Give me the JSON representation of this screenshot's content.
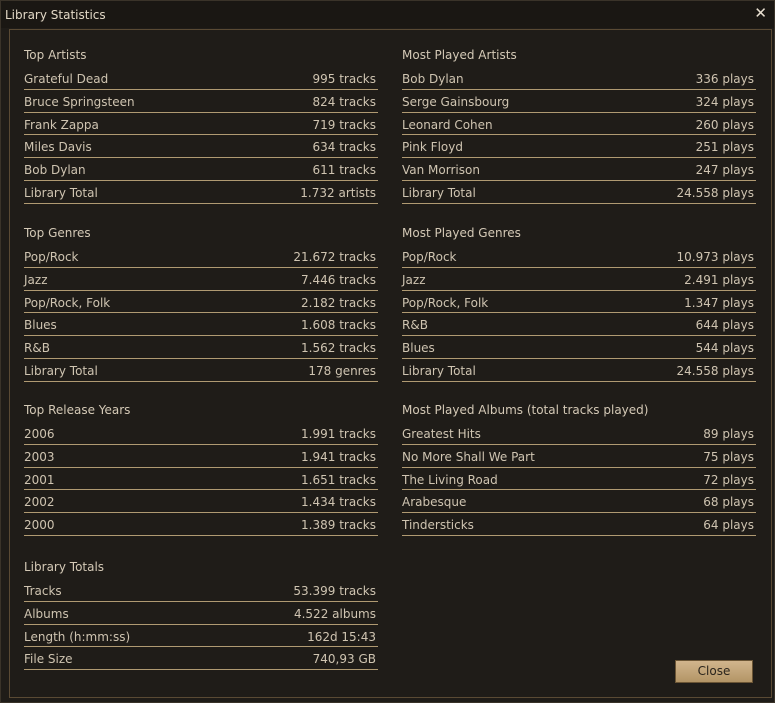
{
  "window": {
    "title": "Library Statistics",
    "close_glyph": "✕"
  },
  "left": {
    "top_artists": {
      "title": "Top Artists",
      "rows": [
        {
          "label": "Grateful Dead",
          "value": "995 tracks"
        },
        {
          "label": "Bruce Springsteen",
          "value": "824 tracks"
        },
        {
          "label": "Frank Zappa",
          "value": "719 tracks"
        },
        {
          "label": "Miles Davis",
          "value": "634 tracks"
        },
        {
          "label": "Bob Dylan",
          "value": "611 tracks"
        },
        {
          "label": "Library Total",
          "value": "1.732 artists"
        }
      ]
    },
    "top_genres": {
      "title": "Top Genres",
      "rows": [
        {
          "label": "Pop/Rock",
          "value": "21.672 tracks"
        },
        {
          "label": "Jazz",
          "value": "7.446 tracks"
        },
        {
          "label": "Pop/Rock, Folk",
          "value": "2.182 tracks"
        },
        {
          "label": "Blues",
          "value": "1.608 tracks"
        },
        {
          "label": "R&B",
          "value": "1.562 tracks"
        },
        {
          "label": "Library Total",
          "value": "178 genres"
        }
      ]
    },
    "top_release_years": {
      "title": "Top Release Years",
      "rows": [
        {
          "label": "2006",
          "value": "1.991 tracks"
        },
        {
          "label": "2003",
          "value": "1.941 tracks"
        },
        {
          "label": "2001",
          "value": "1.651 tracks"
        },
        {
          "label": "2002",
          "value": "1.434 tracks"
        },
        {
          "label": "2000",
          "value": "1.389 tracks"
        }
      ]
    },
    "library_totals": {
      "title": "Library Totals",
      "rows": [
        {
          "label": "Tracks",
          "value": "53.399 tracks"
        },
        {
          "label": "Albums",
          "value": "4.522 albums"
        },
        {
          "label": "Length (h:mm:ss)",
          "value": "162d 15:43"
        },
        {
          "label": "File Size",
          "value": "740,93 GB"
        }
      ]
    }
  },
  "right": {
    "most_played_artists": {
      "title": "Most Played Artists",
      "rows": [
        {
          "label": "Bob Dylan",
          "value": "336 plays"
        },
        {
          "label": "Serge Gainsbourg",
          "value": "324 plays"
        },
        {
          "label": "Leonard Cohen",
          "value": "260 plays"
        },
        {
          "label": "Pink Floyd",
          "value": "251 plays"
        },
        {
          "label": "Van Morrison",
          "value": "247 plays"
        },
        {
          "label": "Library Total",
          "value": "24.558 plays"
        }
      ]
    },
    "most_played_genres": {
      "title": "Most Played Genres",
      "rows": [
        {
          "label": "Pop/Rock",
          "value": "10.973 plays"
        },
        {
          "label": "Jazz",
          "value": "2.491 plays"
        },
        {
          "label": "Pop/Rock, Folk",
          "value": "1.347 plays"
        },
        {
          "label": "R&B",
          "value": "644 plays"
        },
        {
          "label": "Blues",
          "value": "544 plays"
        },
        {
          "label": "Library Total",
          "value": "24.558 plays"
        }
      ]
    },
    "most_played_albums": {
      "title": "Most Played Albums (total tracks played)",
      "rows": [
        {
          "label": "Greatest Hits",
          "value": "89 plays"
        },
        {
          "label": "No More Shall We Part",
          "value": "75 plays"
        },
        {
          "label": "The Living Road",
          "value": "72 plays"
        },
        {
          "label": "Arabesque",
          "value": "68 plays"
        },
        {
          "label": "Tindersticks",
          "value": "64 plays"
        }
      ]
    }
  },
  "buttons": {
    "close_label": "Close"
  }
}
